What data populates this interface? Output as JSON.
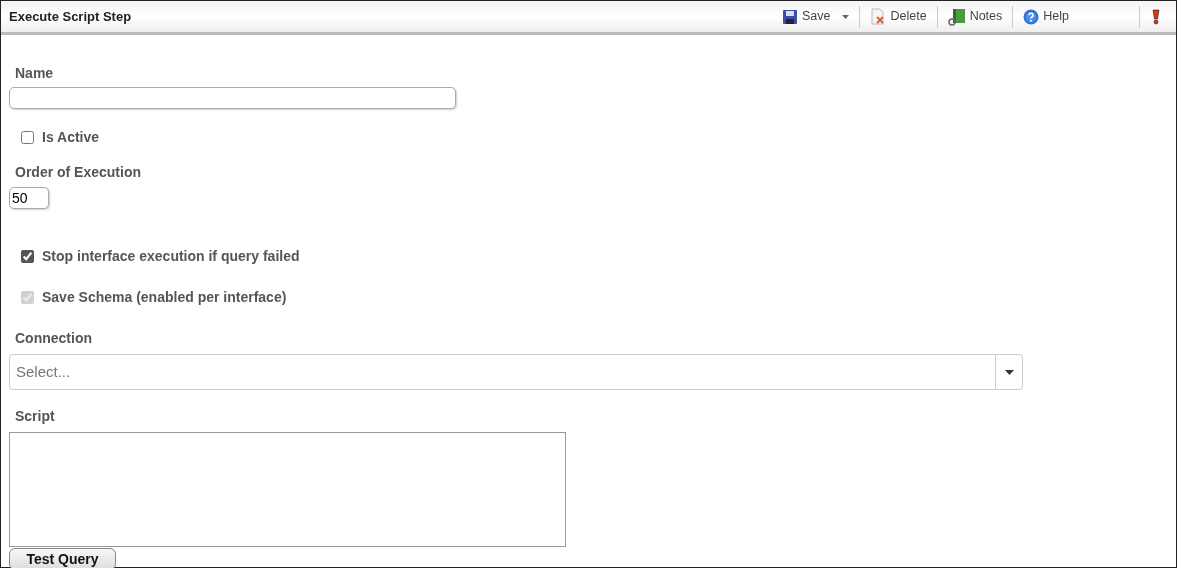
{
  "window": {
    "title": "Execute Script Step"
  },
  "toolbar": [
    {
      "kind": "save",
      "label": "Save",
      "dropdown": true
    },
    {
      "kind": "delete",
      "label": "Delete",
      "dropdown": false
    },
    {
      "kind": "notes",
      "label": "Notes",
      "dropdown": false
    },
    {
      "kind": "help",
      "label": "Help",
      "dropdown": false
    },
    {
      "kind": "alert",
      "dropdown": false
    }
  ],
  "name_field": {
    "label": "Name"
  },
  "is_active": {
    "label": "Is Active",
    "checked": false,
    "disabled": false
  },
  "order_field": {
    "label": "Order of Execution",
    "value": "50"
  },
  "options": [
    {
      "label": "Stop interface execution if query failed",
      "checked": true,
      "disabled": false
    },
    {
      "label": "Save Schema (enabled per interface)",
      "checked": true,
      "disabled": true
    }
  ],
  "connection": {
    "label": "Connection",
    "placeholder": "Select..."
  },
  "script": {
    "label": "Script"
  },
  "test_button": {
    "label": "Test Query"
  }
}
